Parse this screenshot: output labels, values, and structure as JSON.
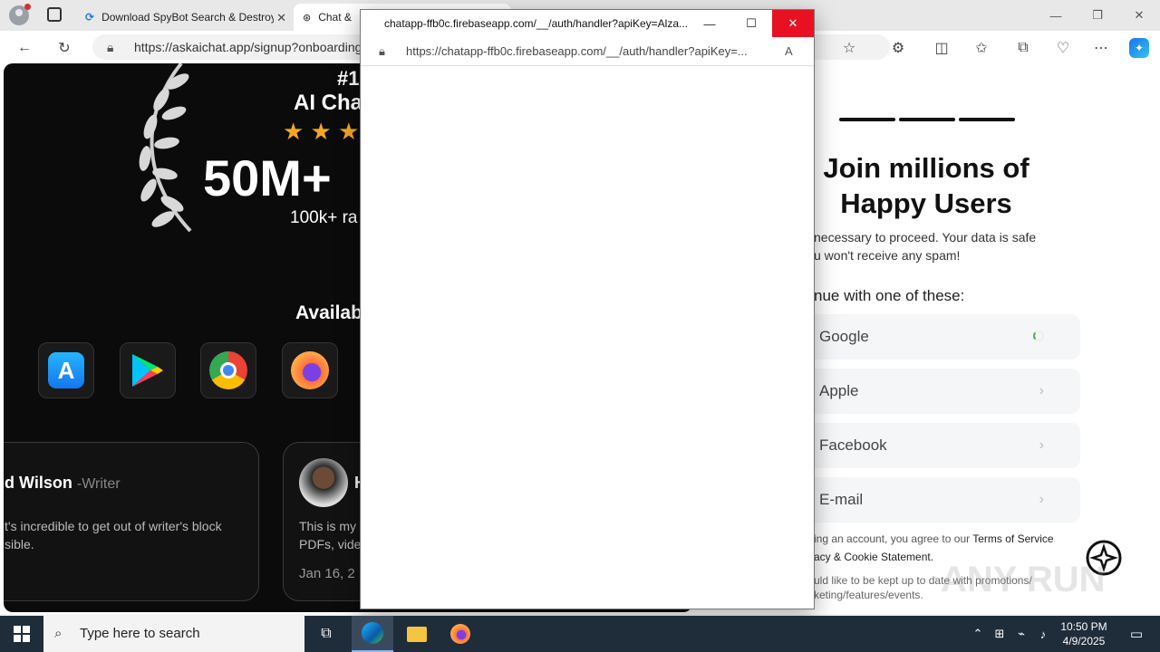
{
  "browser": {
    "tabs": [
      {
        "label": "Download SpyBot Search & Destroy"
      },
      {
        "label": "Chat &"
      }
    ],
    "url": "https://askaichat.app/signup?onboarding"
  },
  "left": {
    "rank": "#1",
    "heading": "AI Cha",
    "stars": "★ ★ ★",
    "users": "50M+",
    "ratings": "100k+ ra",
    "available": "Availab",
    "review1": {
      "name": "d Wilson",
      "role": "-Writer",
      "text1": "t's incredible to get out of writer's block",
      "text2": "sible."
    },
    "review2": {
      "initial": "H",
      "text1": "This is my",
      "text2": "PDFs, vide",
      "date": "Jan 16, 2"
    }
  },
  "right": {
    "heading": "Join millions of Happy Users",
    "line1": "necessary to proceed. Your data is safe",
    "line2": "u won't receive any spam!",
    "continue": "nue with one of these:",
    "providers": [
      "Google",
      "Apple",
      "Facebook",
      "E-mail"
    ],
    "terms_pre": "ing an account, you agree to our ",
    "terms_link": "Terms of Service",
    "terms2": "acy & Cookie Statement.",
    "promo1": "uld like to be kept up to date with promotions/",
    "promo2": "keting/features/events."
  },
  "popup": {
    "title": "chatapp-ffb0c.firebaseapp.com/__/auth/handler?apiKey=Alza...",
    "url": "https://chatapp-ffb0c.firebaseapp.com/__/auth/handler?apiKey=..."
  },
  "watermark": "ANY RUN",
  "taskbar": {
    "search_placeholder": "Type here to search",
    "time": "10:50 PM",
    "date": "4/9/2025"
  }
}
